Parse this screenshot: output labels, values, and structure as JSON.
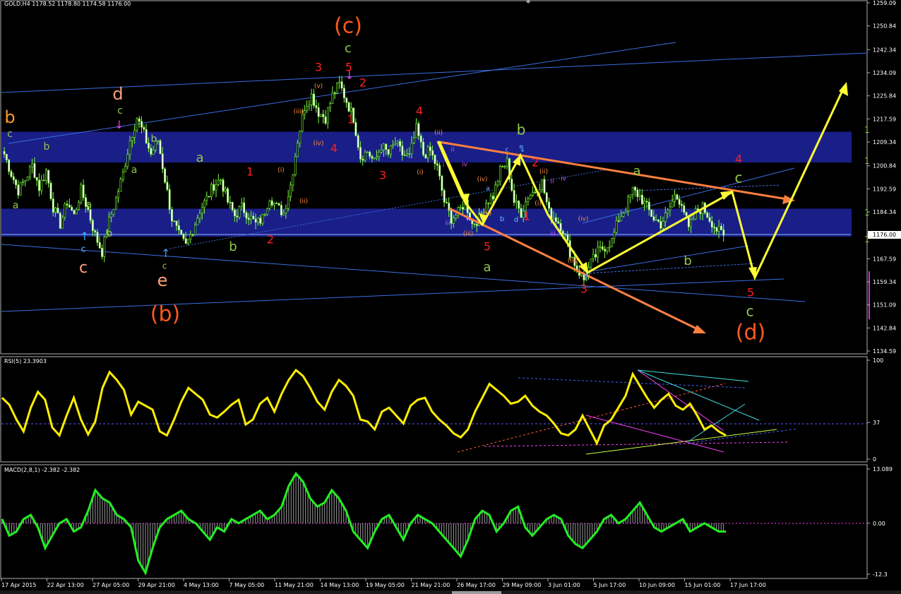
{
  "chart_data": {
    "type": "candlestick",
    "symbol_header": "GOLD,H4  1178.52  1178.80  1174.58  1176.00",
    "price_axis": {
      "ylim": [
        1134.59,
        1259.09
      ],
      "ticks": [
        "1259.09",
        "1250.84",
        "1242.34",
        "1234.09",
        "1225.84",
        "1217.59",
        "1209.34",
        "1200.84",
        "1192.59",
        "1184.34",
        "1176.00",
        "1167.59",
        "1159.34",
        "1151.09",
        "1142.84",
        "1134.59"
      ]
    },
    "x_ticks": [
      "17 Apr 2015",
      "22 Apr 13:00",
      "27 Apr 05:00",
      "29 Apr 21:00",
      "4 May 13:00",
      "7 May 05:00",
      "11 May 21:00",
      "14 May 13:00",
      "19 May 05:00",
      "21 May 21:00",
      "26 May 17:00",
      "29 May 09:00",
      "3 Jun 01:00",
      "5 Jun 17:00",
      "10 Jun 09:00",
      "15 Jun 01:00",
      "17 Jun 17:00"
    ],
    "current_price": "1176.00",
    "price_path": [
      1205,
      1198,
      1192,
      1196,
      1201,
      1193,
      1199,
      1186,
      1180,
      1188,
      1183,
      1192,
      1185,
      1176,
      1170,
      1181,
      1189,
      1198,
      1210,
      1218,
      1212,
      1205,
      1210,
      1196,
      1182,
      1176,
      1172,
      1178,
      1185,
      1189,
      1194,
      1196,
      1188,
      1183,
      1186,
      1183,
      1180,
      1182,
      1190,
      1186,
      1184,
      1194,
      1210,
      1222,
      1226,
      1220,
      1218,
      1226,
      1230,
      1224,
      1218,
      1204,
      1206,
      1202,
      1208,
      1205,
      1209,
      1205,
      1204,
      1214,
      1205,
      1206,
      1200,
      1188,
      1182,
      1184,
      1188,
      1180,
      1182,
      1188,
      1190,
      1199,
      1202,
      1188,
      1184,
      1190,
      1192,
      1195,
      1184,
      1182,
      1178,
      1170,
      1164,
      1160,
      1166,
      1170,
      1172,
      1174,
      1182,
      1186,
      1192,
      1190,
      1186,
      1182,
      1180,
      1184,
      1190,
      1188,
      1178,
      1184,
      1186,
      1182,
      1178,
      1176
    ],
    "zones": [
      {
        "from": 1202.0,
        "to": 1213.0
      },
      {
        "from": 1175.5,
        "to": 1185.5
      }
    ],
    "wave_labels": [
      {
        "text": "(c)",
        "x": 493,
        "y": 38,
        "color": "#ff5a1a",
        "size": 30
      },
      {
        "text": "c",
        "x": 493,
        "y": 69,
        "color": "#8fc848",
        "size": 18
      },
      {
        "text": "3",
        "x": 451,
        "y": 96,
        "color": "#ff2020",
        "size": 16
      },
      {
        "text": "5",
        "x": 494,
        "y": 96,
        "color": "#ff2020",
        "size": 16
      },
      {
        "text": "2",
        "x": 514,
        "y": 118,
        "color": "#ff2020",
        "size": 16
      },
      {
        "text": "1",
        "x": 497,
        "y": 170,
        "color": "#ff2020",
        "size": 16
      },
      {
        "text": "4",
        "x": 473,
        "y": 211,
        "color": "#ff2020",
        "size": 16
      },
      {
        "text": "(v)",
        "x": 451,
        "y": 122,
        "color": "#ff8c40",
        "size": 9
      },
      {
        "text": "(iii)",
        "x": 423,
        "y": 158,
        "color": "#ff8c40",
        "size": 9
      },
      {
        "text": "(iv)",
        "x": 451,
        "y": 203,
        "color": "#ff8c40",
        "size": 9
      },
      {
        "text": "(i)",
        "x": 398,
        "y": 241,
        "color": "#ff8c40",
        "size": 9
      },
      {
        "text": "(ii)",
        "x": 430,
        "y": 285,
        "color": "#ff8c40",
        "size": 9
      },
      {
        "text": "d",
        "x": 167,
        "y": 134,
        "color": "#ffa07a",
        "size": 24
      },
      {
        "text": "c",
        "x": 170,
        "y": 157,
        "color": "#8fc848",
        "size": 14
      },
      {
        "text": "b",
        "x": 14,
        "y": 167,
        "color": "#ff9a2a",
        "size": 24
      },
      {
        "text": "c",
        "x": 14,
        "y": 190,
        "color": "#8fc848",
        "size": 14
      },
      {
        "text": "b",
        "x": 66,
        "y": 208,
        "color": "#8fc848",
        "size": 14
      },
      {
        "text": "b",
        "x": 218,
        "y": 197,
        "color": "#8fc848",
        "size": 14
      },
      {
        "text": "a",
        "x": 190,
        "y": 241,
        "color": "#8fc848",
        "size": 14
      },
      {
        "text": "a",
        "x": 283,
        "y": 224,
        "color": "#8fc848",
        "size": 18
      },
      {
        "text": "1",
        "x": 354,
        "y": 244,
        "color": "#ff2020",
        "size": 16
      },
      {
        "text": "2",
        "x": 383,
        "y": 340,
        "color": "#ff2020",
        "size": 16
      },
      {
        "text": "b",
        "x": 330,
        "y": 350,
        "color": "#8fc848",
        "size": 18
      },
      {
        "text": "a",
        "x": 22,
        "y": 291,
        "color": "#8fc848",
        "size": 14
      },
      {
        "text": "a",
        "x": 126,
        "y": 290,
        "color": "#8fc848",
        "size": 14
      },
      {
        "text": "b",
        "x": 155,
        "y": 331,
        "color": "#8fc848",
        "size": 14
      },
      {
        "text": "c",
        "x": 118,
        "y": 353,
        "color": "#6ab8ff",
        "size": 12
      },
      {
        "text": "c",
        "x": 118,
        "y": 380,
        "color": "#ffa07a",
        "size": 22
      },
      {
        "text": "c",
        "x": 233,
        "y": 377,
        "color": "#8fc848",
        "size": 12
      },
      {
        "text": "e",
        "x": 230,
        "y": 398,
        "color": "#ffa07a",
        "size": 24
      },
      {
        "text": "(b)",
        "x": 234,
        "y": 446,
        "color": "#ff5a1a",
        "size": 30
      },
      {
        "text": "4",
        "x": 594,
        "y": 158,
        "color": "#ff2020",
        "size": 16
      },
      {
        "text": "(ii)",
        "x": 621,
        "y": 188,
        "color": "#ff8c40",
        "size": 9
      },
      {
        "text": "3",
        "x": 542,
        "y": 249,
        "color": "#ff2020",
        "size": 16
      },
      {
        "text": "(i)",
        "x": 595,
        "y": 244,
        "color": "#ff8c40",
        "size": 9
      },
      {
        "text": "ii",
        "x": 641,
        "y": 212,
        "color": "#d050ff",
        "size": 9
      },
      {
        "text": "i",
        "x": 628,
        "y": 234,
        "color": "#d050ff",
        "size": 9
      },
      {
        "text": "iii",
        "x": 634,
        "y": 316,
        "color": "#d050ff",
        "size": 9
      },
      {
        "text": "iv",
        "x": 658,
        "y": 233,
        "color": "#d050ff",
        "size": 9
      },
      {
        "text": "v",
        "x": 662,
        "y": 310,
        "color": "#d050ff",
        "size": 9
      },
      {
        "text": "(iii)",
        "x": 663,
        "y": 331,
        "color": "#ff8c40",
        "size": 9
      },
      {
        "text": "(v)",
        "x": 690,
        "y": 302,
        "color": "#ff8c40",
        "size": 9
      },
      {
        "text": "(iv)",
        "x": 683,
        "y": 254,
        "color": "#ff8c40",
        "size": 9
      },
      {
        "text": "a",
        "x": 691,
        "y": 267,
        "color": "#6ab8ff",
        "size": 9
      },
      {
        "text": "5",
        "x": 690,
        "y": 350,
        "color": "#ff2020",
        "size": 16
      },
      {
        "text": "a",
        "x": 690,
        "y": 379,
        "color": "#8fc848",
        "size": 18
      },
      {
        "text": "b",
        "x": 711,
        "y": 310,
        "color": "#6ab8ff",
        "size": 10
      },
      {
        "text": "d",
        "x": 731,
        "y": 311,
        "color": "#6ab8ff",
        "size": 10
      },
      {
        "text": "c",
        "x": 718,
        "y": 212,
        "color": "#6ab8ff",
        "size": 9
      },
      {
        "text": "e",
        "x": 738,
        "y": 208,
        "color": "#6ab8ff",
        "size": 9
      },
      {
        "text": "b",
        "x": 738,
        "y": 185,
        "color": "#8fc848",
        "size": 20
      },
      {
        "text": "2",
        "x": 758,
        "y": 231,
        "color": "#ff2020",
        "size": 16
      },
      {
        "text": "(ii)",
        "x": 770,
        "y": 243,
        "color": "#ff8c40",
        "size": 9
      },
      {
        "text": "ii",
        "x": 782,
        "y": 257,
        "color": "#d050ff",
        "size": 9
      },
      {
        "text": "(i)",
        "x": 762,
        "y": 288,
        "color": "#ff8c40",
        "size": 9
      },
      {
        "text": "iv",
        "x": 798,
        "y": 253,
        "color": "#d050ff",
        "size": 9
      },
      {
        "text": "1",
        "x": 746,
        "y": 307,
        "color": "#ff2020",
        "size": 16
      },
      {
        "text": "iii",
        "x": 783,
        "y": 331,
        "color": "#d050ff",
        "size": 9
      },
      {
        "text": "(iv)",
        "x": 826,
        "y": 310,
        "color": "#ff8c40",
        "size": 9
      },
      {
        "text": "(iii)",
        "x": 811,
        "y": 369,
        "color": "#ff8c40",
        "size": 9
      },
      {
        "text": "3",
        "x": 827,
        "y": 410,
        "color": "#ff2020",
        "size": 16
      },
      {
        "text": "a",
        "x": 902,
        "y": 243,
        "color": "#8fc848",
        "size": 18
      },
      {
        "text": "b",
        "x": 974,
        "y": 370,
        "color": "#8fc848",
        "size": 18
      },
      {
        "text": "4",
        "x": 1046,
        "y": 226,
        "color": "#ff2020",
        "size": 16
      },
      {
        "text": "c",
        "x": 1046,
        "y": 253,
        "color": "#8fc848",
        "size": 20
      },
      {
        "text": "5",
        "x": 1063,
        "y": 415,
        "color": "#ff2020",
        "size": 16
      },
      {
        "text": "c",
        "x": 1062,
        "y": 442,
        "color": "#8fc848",
        "size": 20
      },
      {
        "text": "(d)",
        "x": 1063,
        "y": 472,
        "color": "#ff5a1a",
        "size": 30
      }
    ],
    "rsi": {
      "label": "RSI(5) 23.3903",
      "ticks": [
        "100",
        "37",
        "0"
      ],
      "ylim": [
        0,
        100
      ],
      "level": 37,
      "values": [
        62,
        55,
        40,
        28,
        52,
        68,
        60,
        32,
        24,
        44,
        62,
        40,
        25,
        38,
        72,
        88,
        80,
        70,
        45,
        58,
        54,
        50,
        28,
        24,
        40,
        58,
        72,
        66,
        60,
        45,
        42,
        48,
        55,
        60,
        35,
        40,
        56,
        62,
        48,
        66,
        80,
        90,
        84,
        72,
        58,
        50,
        68,
        80,
        74,
        64,
        40,
        38,
        30,
        48,
        52,
        44,
        36,
        54,
        60,
        62,
        48,
        40,
        34,
        26,
        22,
        30,
        48,
        62,
        76,
        70,
        64,
        56,
        58,
        64,
        54,
        48,
        44,
        36,
        26,
        24,
        30,
        44,
        30,
        16,
        34,
        40,
        52,
        64,
        86,
        74,
        62,
        52,
        60,
        66,
        54,
        50,
        56,
        44,
        30,
        34,
        28,
        24
      ]
    },
    "macd": {
      "label": "MACD(2,8,1) -2.382 -2.382",
      "ticks": [
        "13.089",
        "0.00",
        "-12.3"
      ],
      "ylim": [
        -12.3,
        13.089
      ],
      "values": [
        1,
        -3,
        -2,
        1,
        2,
        -1,
        -6,
        -3,
        0,
        1,
        -2,
        -1,
        3,
        8,
        6,
        5,
        2,
        1,
        -1,
        -9,
        -12,
        -6,
        -1,
        1,
        2,
        3,
        1,
        0,
        -2,
        -4,
        -1,
        -2,
        1,
        0,
        1,
        2,
        3,
        1,
        2,
        4,
        9,
        12,
        10,
        6,
        4,
        5,
        8,
        6,
        3,
        -2,
        -4,
        -6,
        -2,
        1,
        2,
        -1,
        -4,
        0,
        2,
        1,
        0,
        -2,
        -4,
        -6,
        -8,
        -4,
        1,
        3,
        2,
        -2,
        0,
        3,
        4,
        -1,
        -3,
        -1,
        1,
        2,
        1,
        -3,
        -5,
        -6,
        -4,
        -2,
        1,
        2,
        0,
        1,
        3,
        5,
        2,
        -1,
        -2,
        -1,
        0,
        1,
        -2,
        -1,
        0,
        -1,
        -2,
        -2
      ]
    }
  }
}
